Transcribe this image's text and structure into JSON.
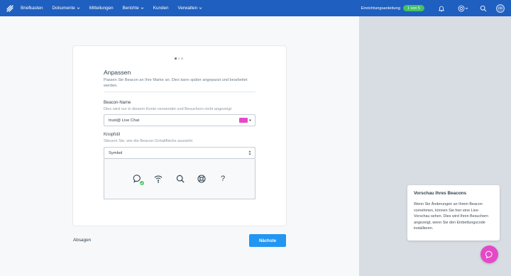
{
  "nav": {
    "items": [
      {
        "label": "Briefkasten",
        "has_dropdown": false
      },
      {
        "label": "Dokumente",
        "has_dropdown": true
      },
      {
        "label": "Mitteilungen",
        "has_dropdown": false
      },
      {
        "label": "Berichte",
        "has_dropdown": true
      },
      {
        "label": "Kunden",
        "has_dropdown": false
      },
      {
        "label": "Verwalten",
        "has_dropdown": true
      }
    ],
    "setup_label": "Einrichtungsanleitung",
    "setup_progress": "1 von 5",
    "avatar_initials": "PR",
    "icons": [
      "bell-icon",
      "help-icon",
      "search-icon",
      "avatar"
    ],
    "brand_color": "#1f5fbf"
  },
  "wizard": {
    "step_count": 3,
    "active_step": 1,
    "title": "Anpassen",
    "subtitle": "Passen Sie Beacon an Ihre Marke an. Dies kann später angepasst und bearbeitet werden.",
    "beacon_name": {
      "label": "Beacon-Name",
      "help": "Dies wird nur in diesem Konto verwendet und Besuchern nicht angezeigt",
      "value": "trust@ Live Chat",
      "color": "#e549c7"
    },
    "button_style": {
      "label": "Knopfstil",
      "help": "Steuern Sie, wie die Beacon-Schaltfläche aussieht",
      "value": "Symbol",
      "options_icons": [
        "chat-bubble-icon",
        "wifi-beacon-icon",
        "search-bubble-icon",
        "lifebuoy-icon",
        "question-mark-icon"
      ],
      "selected_index": 0,
      "question_glyph": "?"
    },
    "cancel_label": "Absagen",
    "next_label": "Nächste"
  },
  "preview": {
    "title": "Vorschau Ihres Beacons",
    "text": "Wenn Sie Änderungen an Ihrem Beacon vornehmen, können Sie hier eine Live-Vorschau sehen. Dies wird Ihren Besuchern angezeigt, wenn Sie den Einbettungscode installieren.",
    "fab_color": "#e549c7"
  }
}
